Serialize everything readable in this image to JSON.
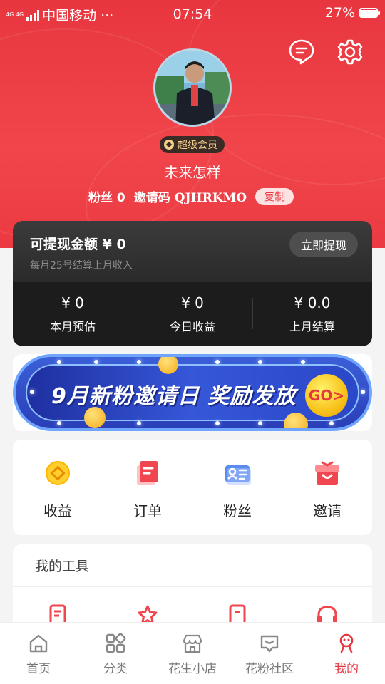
{
  "status_bar": {
    "network": "4G 4G",
    "carrier": "中国移动 ···",
    "time": "07:54",
    "battery": "27%"
  },
  "profile": {
    "badge": "超级会员",
    "nickname": "未来怎样",
    "fans_label": "粉丝 0",
    "invite_label": "邀请码 QJHRKMO",
    "copy_label": "复制"
  },
  "balance": {
    "title": "可提现金额  ¥ 0",
    "subtitle": "每月25号结算上月收入",
    "withdraw_label": "立即提现",
    "stats": [
      {
        "value": "¥ 0",
        "label": "本月预估"
      },
      {
        "value": "¥ 0",
        "label": "今日收益"
      },
      {
        "value": "¥ 0.0",
        "label": "上月结算"
      }
    ]
  },
  "banner": {
    "text": "9月新粉邀请日 奖励发放",
    "go_label": "GO>"
  },
  "quick_actions": [
    {
      "label": "收益",
      "icon": "coin-icon"
    },
    {
      "label": "订单",
      "icon": "order-icon"
    },
    {
      "label": "粉丝",
      "icon": "fans-card-icon"
    },
    {
      "label": "邀请",
      "icon": "gift-icon"
    }
  ],
  "tools": {
    "title": "我的工具",
    "icons": [
      "document-icon",
      "star-icon",
      "file-icon",
      "headset-icon"
    ]
  },
  "tabbar": {
    "items": [
      {
        "label": "首页",
        "icon": "home-icon"
      },
      {
        "label": "分类",
        "icon": "category-icon"
      },
      {
        "label": "花生小店",
        "icon": "shop-icon"
      },
      {
        "label": "花粉社区",
        "icon": "community-icon"
      },
      {
        "label": "我的",
        "icon": "profile-icon"
      }
    ],
    "active_index": 4
  },
  "colors": {
    "brand_red": "#e8363f",
    "card_dark": "#2a2a2a",
    "vip_gold": "#f3cf8a"
  }
}
